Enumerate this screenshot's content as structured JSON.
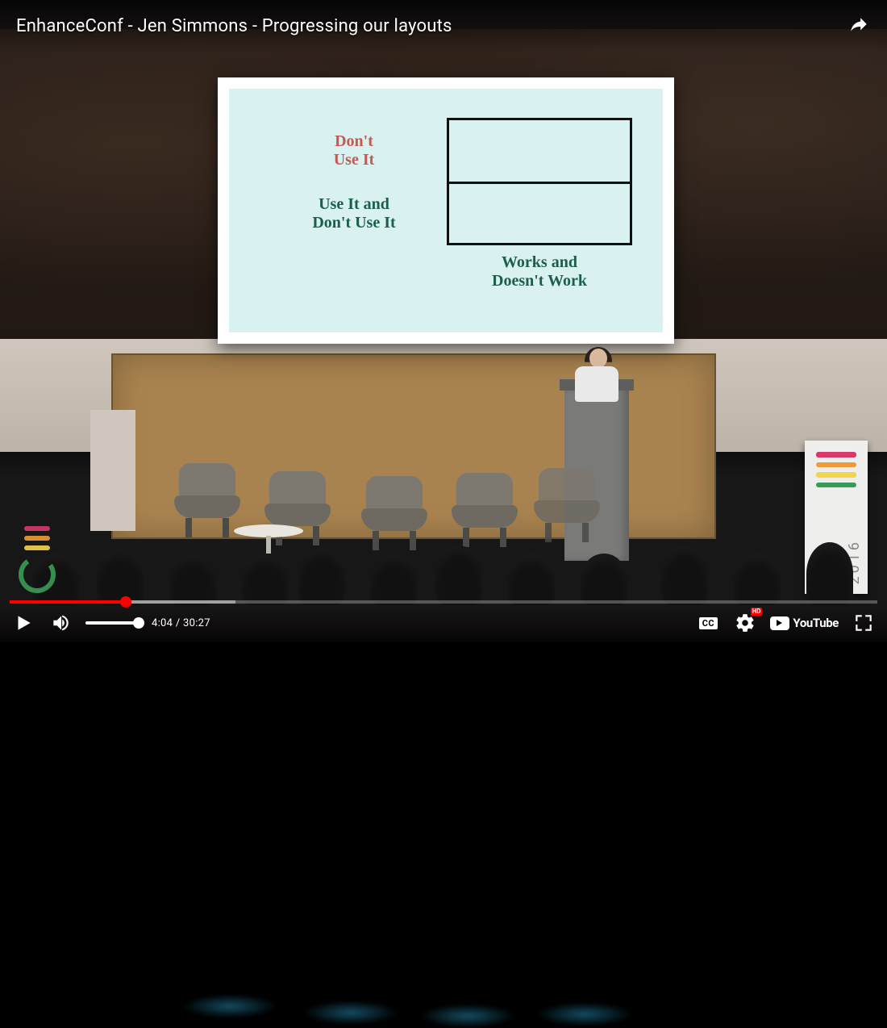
{
  "video": {
    "title": "EnhanceConf - Jen Simmons - Progressing our layouts",
    "current_time": "4:04",
    "duration": "30:27",
    "progress_fraction": 0.1336,
    "loaded_fraction": 0.26
  },
  "slide": {
    "row1_label": "Don't\nUse It",
    "row2_label": "Use It and\nDon't Use It",
    "col_label": "Works and\nDoesn't Work"
  },
  "banner": {
    "year": "2016"
  },
  "controls": {
    "cc_label": "CC",
    "hd_label": "HD",
    "youtube_label": "YouTube"
  },
  "icons": {
    "share": "share-icon",
    "play": "play-icon",
    "volume": "volume-icon",
    "cc": "cc-icon",
    "settings": "settings-icon",
    "youtube": "youtube-logo-icon",
    "fullscreen": "fullscreen-icon"
  }
}
